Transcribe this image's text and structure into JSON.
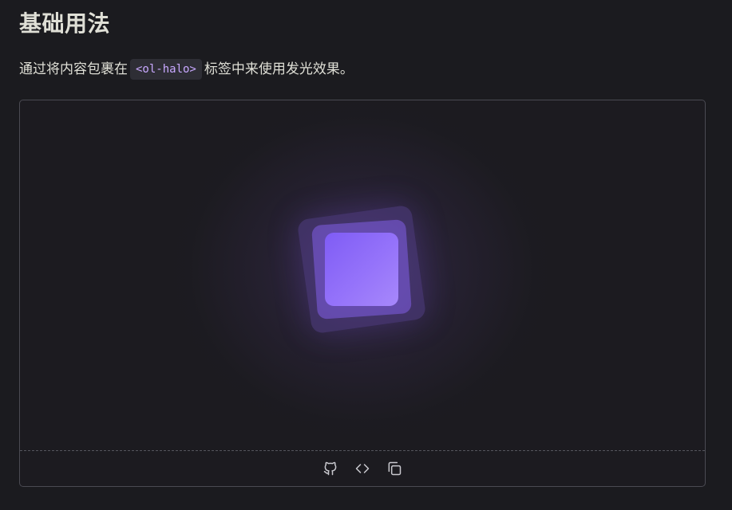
{
  "section": {
    "title": "基础用法",
    "description_before": "通过将内容包裹在",
    "code_tag": "<ol-halo>",
    "description_after": "标签中来使用发光效果。"
  },
  "demo": {
    "accent_color": "#8b66f8",
    "toolbar": {
      "buttons": [
        {
          "icon": "github-icon"
        },
        {
          "icon": "code-icon"
        },
        {
          "icon": "copy-icon"
        }
      ]
    }
  }
}
